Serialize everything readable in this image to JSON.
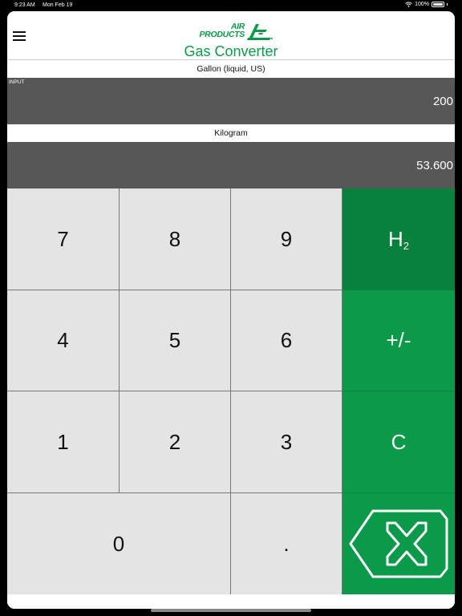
{
  "status": {
    "time": "9:23 AM",
    "date": "Mon Feb 19",
    "battery": "100%"
  },
  "header": {
    "logo_line1": "AIR",
    "logo_line2": "PRODUCTS",
    "title": "Gas Converter"
  },
  "input": {
    "unit": "Gallon (liquid, US)",
    "caption": "INPUT",
    "value": "200"
  },
  "output": {
    "unit": "Kilogram",
    "value": "53.600"
  },
  "keypad": {
    "k7": "7",
    "k8": "8",
    "k9": "9",
    "k4": "4",
    "k5": "5",
    "k6": "6",
    "k1": "1",
    "k2": "2",
    "k3": "3",
    "k0": "0",
    "dot": ".",
    "gas_main": "H",
    "gas_sub": "2",
    "sign": "+/-",
    "clear": "C"
  },
  "colors": {
    "brand_green": "#0a9a49",
    "dark_green": "#08813d",
    "display_gray": "#575757"
  },
  "icons": {
    "menu": "hamburger-icon",
    "backspace": "backspace-x-icon"
  }
}
